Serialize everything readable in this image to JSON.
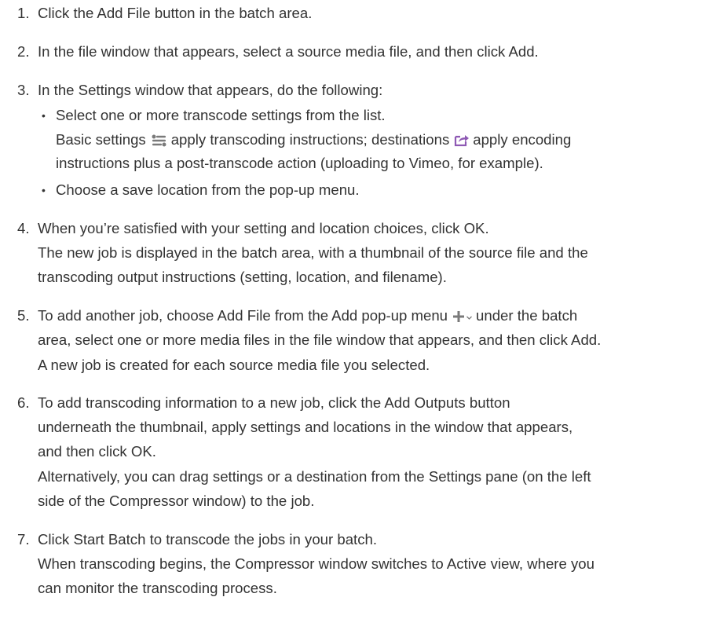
{
  "steps": [
    {
      "num": "1.",
      "text": "Click the Add File button in the batch area."
    },
    {
      "num": "2.",
      "text": "In the file window that appears, select a source media file, and then click Add."
    },
    {
      "num": "3.",
      "text": "In the Settings window that appears, do the following:",
      "bullets": [
        {
          "text": "Select one or more transcode settings from the list."
        },
        {
          "text": "Choose a save location from the pop-up menu."
        }
      ],
      "note": {
        "part1": "Basic settings",
        "part2": "apply transcoding instructions; destinations",
        "part3": "apply encoding",
        "line2": "instructions plus a post-transcode action (uploading to Vimeo, for example)."
      }
    },
    {
      "num": "4.",
      "text": "When you’re satisfied with your setting and location choices, click OK.",
      "detail": [
        "The new job is displayed in the batch area, with a thumbnail of the source file and the",
        "transcoding output instructions (setting, location, and filename)."
      ]
    },
    {
      "num": "5.",
      "text_a": "To add another job, choose Add File from the Add pop-up menu",
      "text_b": "under the batch",
      "lines": [
        "area, select one or more media files in the file window that appears, and then click Add.",
        "A new job is created for each source media file you selected."
      ]
    },
    {
      "num": "6.",
      "lines": [
        "To add transcoding information to a new job, click the Add Outputs button",
        "underneath the thumbnail, apply settings and locations in the window that appears,",
        "and then click OK."
      ],
      "detail": [
        "Alternatively, you can drag settings or a destination from the Settings pane (on the left",
        "side of the Compressor window) to the job."
      ]
    },
    {
      "num": "7.",
      "text": "Click Start Batch to transcode the jobs in your batch.",
      "detail": [
        "When transcoding begins, the Compressor window switches to Active view, where you",
        "can monitor the transcoding process."
      ]
    }
  ],
  "bullet_char": "•",
  "icons": [
    "basic-settings-icon",
    "destination-share-icon",
    "add-plus-icon",
    "popup-chevron-icon"
  ],
  "colors": {
    "text": "#333333",
    "accent": "#8e59b4",
    "icon_gray": "#7a7a7a"
  }
}
